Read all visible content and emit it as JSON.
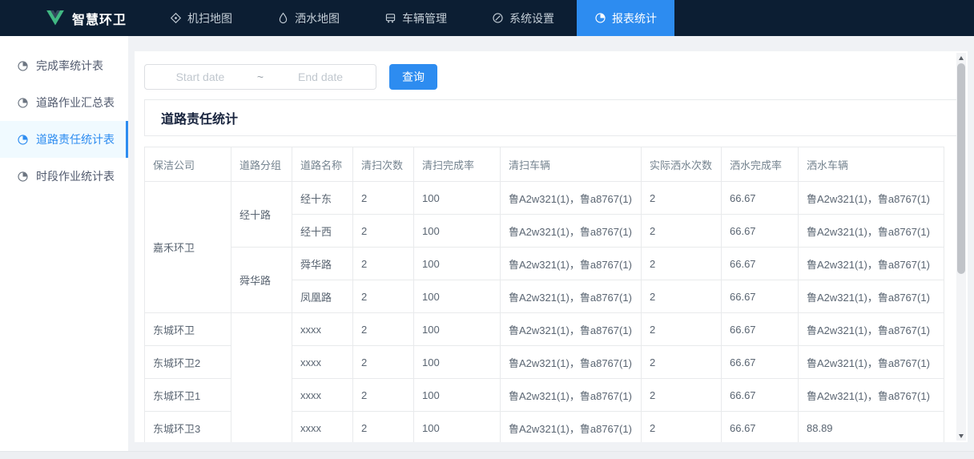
{
  "colors": {
    "primary": "#2d8cf0",
    "nav_bg": "#0c1e33",
    "logo_green": "#41b883"
  },
  "brand": {
    "title": "智慧环卫"
  },
  "nav": {
    "items": [
      {
        "label": "机扫地图",
        "icon": "sweep-map-icon",
        "active": false
      },
      {
        "label": "洒水地图",
        "icon": "water-map-icon",
        "active": false
      },
      {
        "label": "车辆管理",
        "icon": "vehicle-icon",
        "active": false
      },
      {
        "label": "系统设置",
        "icon": "settings-icon",
        "active": false
      },
      {
        "label": "报表统计",
        "icon": "report-icon",
        "active": true
      }
    ]
  },
  "sidebar": {
    "items": [
      {
        "label": "完成率统计表",
        "icon": "pie-chart-icon",
        "active": false
      },
      {
        "label": "道路作业汇总表",
        "icon": "pie-chart-icon",
        "active": false
      },
      {
        "label": "道路责任统计表",
        "icon": "pie-chart-icon",
        "active": true
      },
      {
        "label": "时段作业统计表",
        "icon": "pie-chart-icon",
        "active": false
      }
    ]
  },
  "toolbar": {
    "start_placeholder": "Start date",
    "separator": "~",
    "end_placeholder": "End date",
    "query_label": "查询"
  },
  "panel": {
    "title": "道路责任统计"
  },
  "table": {
    "columns": [
      "保洁公司",
      "道路分组",
      "道路名称",
      "清扫次数",
      "清扫完成率",
      "清扫车辆",
      "实际洒水次数",
      "洒水完成率",
      "洒水车辆"
    ],
    "rows": [
      [
        {
          "t": "嘉禾环卫",
          "rs": 4
        },
        {
          "t": "经十路",
          "rs": 2
        },
        {
          "t": "经十东"
        },
        {
          "t": "2"
        },
        {
          "t": "100"
        },
        {
          "t": "鲁A2w321(1)，鲁a8767(1)"
        },
        {
          "t": "2"
        },
        {
          "t": "66.67"
        },
        {
          "t": "鲁A2w321(1)，鲁a8767(1)"
        }
      ],
      [
        {
          "t": "经十西"
        },
        {
          "t": "2"
        },
        {
          "t": "100"
        },
        {
          "t": "鲁A2w321(1)，鲁a8767(1)"
        },
        {
          "t": "2"
        },
        {
          "t": "66.67"
        },
        {
          "t": "鲁A2w321(1)，鲁a8767(1)"
        }
      ],
      [
        {
          "t": "舜华路",
          "rs": 2
        },
        {
          "t": "舜华路"
        },
        {
          "t": "2"
        },
        {
          "t": "100"
        },
        {
          "t": "鲁A2w321(1)，鲁a8767(1)"
        },
        {
          "t": "2"
        },
        {
          "t": "66.67"
        },
        {
          "t": "鲁A2w321(1)，鲁a8767(1)"
        }
      ],
      [
        {
          "t": "凤凰路"
        },
        {
          "t": "2"
        },
        {
          "t": "100"
        },
        {
          "t": "鲁A2w321(1)，鲁a8767(1)"
        },
        {
          "t": "2"
        },
        {
          "t": "66.67"
        },
        {
          "t": "鲁A2w321(1)，鲁a8767(1)"
        }
      ],
      [
        {
          "t": "东城环卫"
        },
        {
          "t": "",
          "rs": 4
        },
        {
          "t": "xxxx"
        },
        {
          "t": "2"
        },
        {
          "t": "100"
        },
        {
          "t": "鲁A2w321(1)，鲁a8767(1)"
        },
        {
          "t": "2"
        },
        {
          "t": "66.67"
        },
        {
          "t": "鲁A2w321(1)，鲁a8767(1)"
        }
      ],
      [
        {
          "t": "东城环卫2"
        },
        {
          "t": "xxxx"
        },
        {
          "t": "2"
        },
        {
          "t": "100"
        },
        {
          "t": "鲁A2w321(1)，鲁a8767(1)"
        },
        {
          "t": "2"
        },
        {
          "t": "66.67"
        },
        {
          "t": "鲁A2w321(1)，鲁a8767(1)"
        }
      ],
      [
        {
          "t": "东城环卫1"
        },
        {
          "t": "xxxx"
        },
        {
          "t": "2"
        },
        {
          "t": "100"
        },
        {
          "t": "鲁A2w321(1)，鲁a8767(1)"
        },
        {
          "t": "2"
        },
        {
          "t": "66.67"
        },
        {
          "t": "鲁A2w321(1)，鲁a8767(1)"
        }
      ],
      [
        {
          "t": "东城环卫3"
        },
        {
          "t": "xxxx"
        },
        {
          "t": "2"
        },
        {
          "t": "100"
        },
        {
          "t": "鲁A2w321(1)，鲁a8767(1)"
        },
        {
          "t": "2"
        },
        {
          "t": "66.67"
        },
        {
          "t": "88.89"
        }
      ]
    ]
  }
}
